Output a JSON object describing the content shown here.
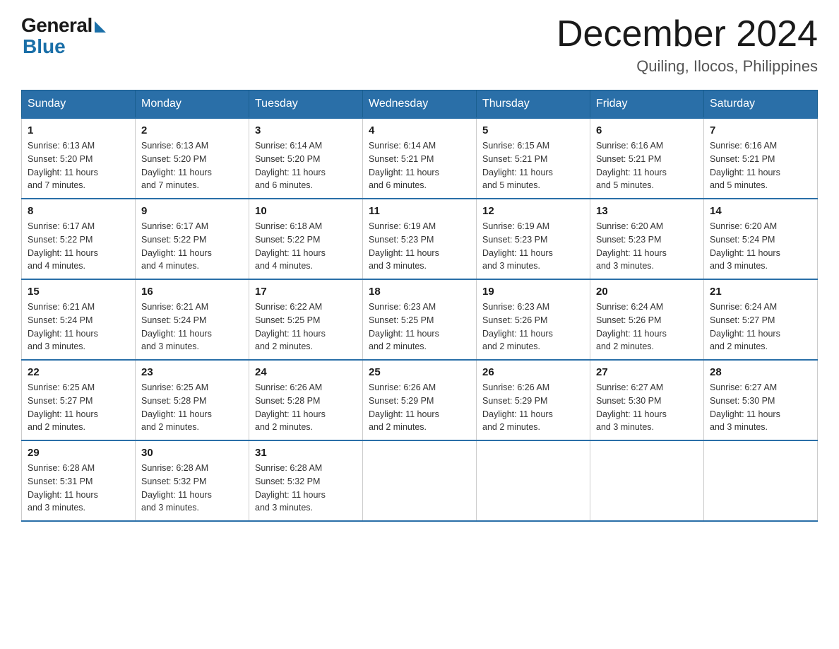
{
  "header": {
    "logo_general": "General",
    "logo_blue": "Blue",
    "month_title": "December 2024",
    "location": "Quiling, Ilocos, Philippines"
  },
  "calendar": {
    "days_of_week": [
      "Sunday",
      "Monday",
      "Tuesday",
      "Wednesday",
      "Thursday",
      "Friday",
      "Saturday"
    ],
    "weeks": [
      [
        {
          "day": "1",
          "sunrise": "6:13 AM",
          "sunset": "5:20 PM",
          "daylight": "11 hours and 7 minutes."
        },
        {
          "day": "2",
          "sunrise": "6:13 AM",
          "sunset": "5:20 PM",
          "daylight": "11 hours and 7 minutes."
        },
        {
          "day": "3",
          "sunrise": "6:14 AM",
          "sunset": "5:20 PM",
          "daylight": "11 hours and 6 minutes."
        },
        {
          "day": "4",
          "sunrise": "6:14 AM",
          "sunset": "5:21 PM",
          "daylight": "11 hours and 6 minutes."
        },
        {
          "day": "5",
          "sunrise": "6:15 AM",
          "sunset": "5:21 PM",
          "daylight": "11 hours and 5 minutes."
        },
        {
          "day": "6",
          "sunrise": "6:16 AM",
          "sunset": "5:21 PM",
          "daylight": "11 hours and 5 minutes."
        },
        {
          "day": "7",
          "sunrise": "6:16 AM",
          "sunset": "5:21 PM",
          "daylight": "11 hours and 5 minutes."
        }
      ],
      [
        {
          "day": "8",
          "sunrise": "6:17 AM",
          "sunset": "5:22 PM",
          "daylight": "11 hours and 4 minutes."
        },
        {
          "day": "9",
          "sunrise": "6:17 AM",
          "sunset": "5:22 PM",
          "daylight": "11 hours and 4 minutes."
        },
        {
          "day": "10",
          "sunrise": "6:18 AM",
          "sunset": "5:22 PM",
          "daylight": "11 hours and 4 minutes."
        },
        {
          "day": "11",
          "sunrise": "6:19 AM",
          "sunset": "5:23 PM",
          "daylight": "11 hours and 3 minutes."
        },
        {
          "day": "12",
          "sunrise": "6:19 AM",
          "sunset": "5:23 PM",
          "daylight": "11 hours and 3 minutes."
        },
        {
          "day": "13",
          "sunrise": "6:20 AM",
          "sunset": "5:23 PM",
          "daylight": "11 hours and 3 minutes."
        },
        {
          "day": "14",
          "sunrise": "6:20 AM",
          "sunset": "5:24 PM",
          "daylight": "11 hours and 3 minutes."
        }
      ],
      [
        {
          "day": "15",
          "sunrise": "6:21 AM",
          "sunset": "5:24 PM",
          "daylight": "11 hours and 3 minutes."
        },
        {
          "day": "16",
          "sunrise": "6:21 AM",
          "sunset": "5:24 PM",
          "daylight": "11 hours and 3 minutes."
        },
        {
          "day": "17",
          "sunrise": "6:22 AM",
          "sunset": "5:25 PM",
          "daylight": "11 hours and 2 minutes."
        },
        {
          "day": "18",
          "sunrise": "6:23 AM",
          "sunset": "5:25 PM",
          "daylight": "11 hours and 2 minutes."
        },
        {
          "day": "19",
          "sunrise": "6:23 AM",
          "sunset": "5:26 PM",
          "daylight": "11 hours and 2 minutes."
        },
        {
          "day": "20",
          "sunrise": "6:24 AM",
          "sunset": "5:26 PM",
          "daylight": "11 hours and 2 minutes."
        },
        {
          "day": "21",
          "sunrise": "6:24 AM",
          "sunset": "5:27 PM",
          "daylight": "11 hours and 2 minutes."
        }
      ],
      [
        {
          "day": "22",
          "sunrise": "6:25 AM",
          "sunset": "5:27 PM",
          "daylight": "11 hours and 2 minutes."
        },
        {
          "day": "23",
          "sunrise": "6:25 AM",
          "sunset": "5:28 PM",
          "daylight": "11 hours and 2 minutes."
        },
        {
          "day": "24",
          "sunrise": "6:26 AM",
          "sunset": "5:28 PM",
          "daylight": "11 hours and 2 minutes."
        },
        {
          "day": "25",
          "sunrise": "6:26 AM",
          "sunset": "5:29 PM",
          "daylight": "11 hours and 2 minutes."
        },
        {
          "day": "26",
          "sunrise": "6:26 AM",
          "sunset": "5:29 PM",
          "daylight": "11 hours and 2 minutes."
        },
        {
          "day": "27",
          "sunrise": "6:27 AM",
          "sunset": "5:30 PM",
          "daylight": "11 hours and 3 minutes."
        },
        {
          "day": "28",
          "sunrise": "6:27 AM",
          "sunset": "5:30 PM",
          "daylight": "11 hours and 3 minutes."
        }
      ],
      [
        {
          "day": "29",
          "sunrise": "6:28 AM",
          "sunset": "5:31 PM",
          "daylight": "11 hours and 3 minutes."
        },
        {
          "day": "30",
          "sunrise": "6:28 AM",
          "sunset": "5:32 PM",
          "daylight": "11 hours and 3 minutes."
        },
        {
          "day": "31",
          "sunrise": "6:28 AM",
          "sunset": "5:32 PM",
          "daylight": "11 hours and 3 minutes."
        },
        null,
        null,
        null,
        null
      ]
    ],
    "labels": {
      "sunrise": "Sunrise:",
      "sunset": "Sunset:",
      "daylight": "Daylight:"
    }
  }
}
